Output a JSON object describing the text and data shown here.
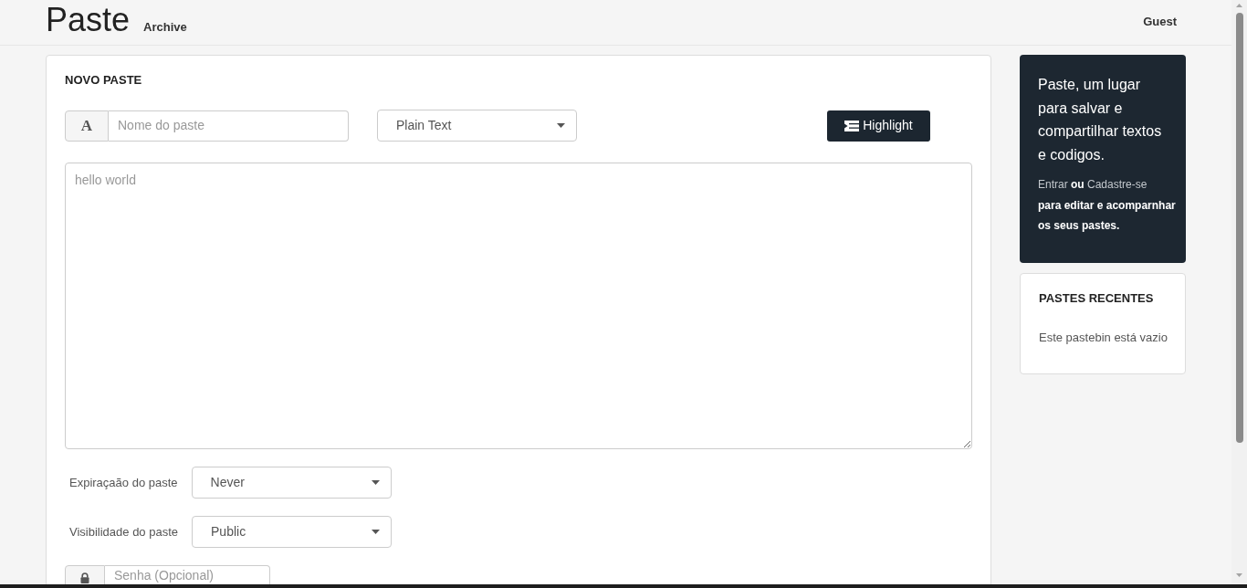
{
  "navbar": {
    "brand": "Paste",
    "links": [
      {
        "label": "Archive"
      }
    ],
    "user": "Guest"
  },
  "new_paste": {
    "title": "NOVO PASTE",
    "name_field": {
      "addon": "A",
      "placeholder": "Nome do paste"
    },
    "syntax_select": {
      "value": "Plain Text"
    },
    "highlight_button": {
      "label": "Highlight"
    },
    "content": {
      "placeholder": "hello world"
    },
    "options": [
      {
        "label": "Expiraçaão do paste",
        "value": "Never"
      },
      {
        "label": "Visibilidade do paste",
        "value": "Public"
      }
    ],
    "password_field": {
      "placeholder": "Senha (Opcional)"
    }
  },
  "sidebar": {
    "intro": {
      "text": "Paste, um lugar para salvar e compartilhar textos e codigos.",
      "login_link": "Entrar",
      "joiner": "ou",
      "signup_link": "Cadastre-se",
      "rest": "para editar e acomparnhar os seus pastes."
    },
    "recent": {
      "title": "PASTES RECENTES",
      "empty_text": "Este pastebin está vazio"
    }
  }
}
